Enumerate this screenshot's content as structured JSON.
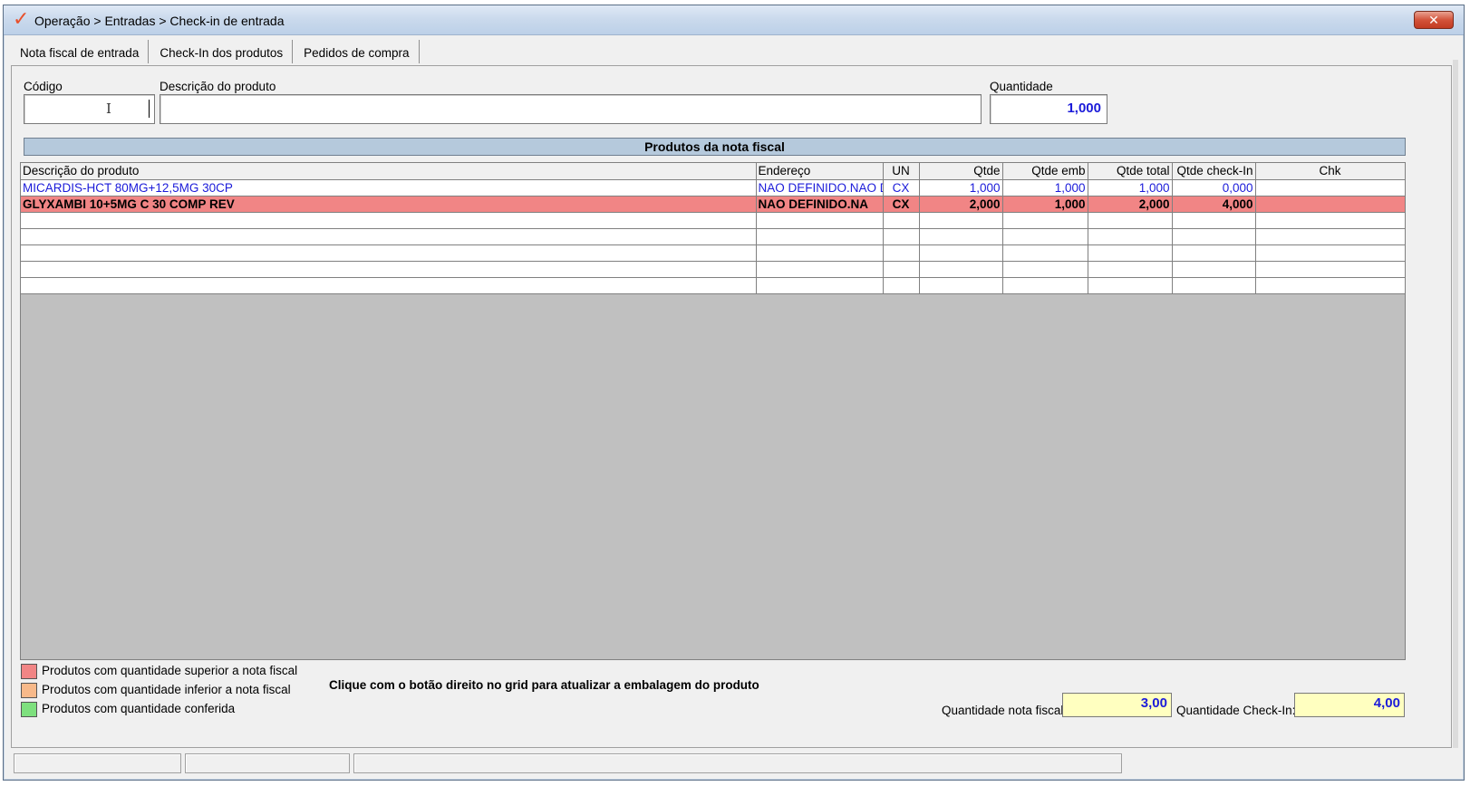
{
  "window": {
    "title": "Operação > Entradas > Check-in de entrada",
    "close_label": "✕"
  },
  "tabs": [
    {
      "label": "Nota fiscal de entrada"
    },
    {
      "label": "Check-In dos produtos"
    },
    {
      "label": "Pedidos de compra"
    }
  ],
  "form": {
    "codigo_label": "Código",
    "codigo_value": "",
    "descricao_label": "Descrição do produto",
    "descricao_value": "",
    "quantidade_label": "Quantidade",
    "quantidade_value": "1,000"
  },
  "grid": {
    "title": "Produtos da nota fiscal",
    "columns": [
      "Descrição do produto",
      "Endereço",
      "UN",
      "Qtde",
      "Qtde emb",
      "Qtde total",
      "Qtde check-In",
      "Chk"
    ],
    "rows": [
      {
        "descricao": "MICARDIS-HCT 80MG+12,5MG 30CP",
        "endereco": "NAO DEFINIDO.NAO D",
        "un": "CX",
        "qtde": "1,000",
        "qtde_emb": "1,000",
        "qtde_total": "1,000",
        "qtde_checkin": "0,000",
        "chk": ""
      },
      {
        "descricao": "GLYXAMBI 10+5MG C 30 COMP REV",
        "endereco": "NAO DEFINIDO.NA",
        "un": "CX",
        "qtde": "2,000",
        "qtde_emb": "1,000",
        "qtde_total": "2,000",
        "qtde_checkin": "4,000",
        "chk": ""
      }
    ]
  },
  "legend": {
    "superior": {
      "label": "Produtos com quantidade superior a nota fiscal",
      "color": "#f18585"
    },
    "inferior": {
      "label": "Produtos com quantidade inferior a nota fiscal",
      "color": "#f7b98a"
    },
    "conferida": {
      "label": "Produtos com quantidade conferida",
      "color": "#7ee07e"
    }
  },
  "hint": "Clique com o botão direito no grid para atualizar a embalagem do produto",
  "totals": {
    "nota_fiscal_label": "Quantidade nota fiscal:",
    "nota_fiscal_value": "3,00",
    "checkin_label": "Quantidade Check-In:",
    "checkin_value": "4,00"
  },
  "status_bar": [
    "",
    "",
    ""
  ]
}
